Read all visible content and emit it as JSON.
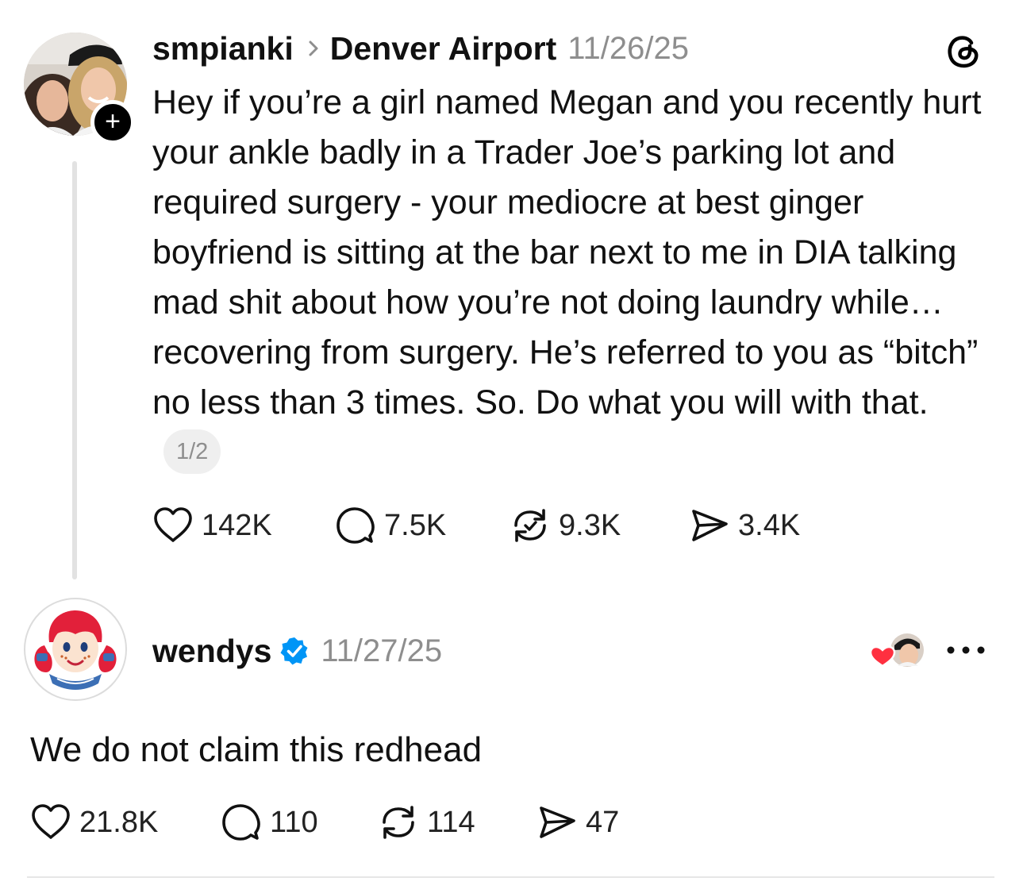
{
  "post": {
    "author": "smpianki",
    "location": "Denver Airport",
    "date": "11/26/25",
    "paragraphs": [
      "Hey if you’re a girl named Megan and you recently hurt your ankle badly in a Trader Joe’s parking lot and required surgery - your mediocre at best ginger boyfriend is sitting at the bar next to me in DIA talking mad shit about how you’re not doing laundry while…recovering from surgery. He’s referred to you as “bitch” no less than 3 times. So. Do what you will with that."
    ],
    "pager": "1/2",
    "stats": {
      "likes": "142K",
      "replies": "7.5K",
      "reposts": "9.3K",
      "shares": "3.4K"
    },
    "icons": [
      "plus-icon",
      "chevron-right-icon",
      "threads-logo-icon",
      "heart-icon",
      "comment-icon",
      "repost-icon",
      "share-icon"
    ]
  },
  "reply": {
    "author": "wendys",
    "verified": true,
    "date": "11/27/25",
    "text": "We do not claim this redhead",
    "stats": {
      "likes": "21.8K",
      "replies": "110",
      "reposts": "114",
      "shares": "47"
    },
    "icons": [
      "verified-badge-icon",
      "liked-by-author-heart-icon",
      "more-options-icon"
    ]
  },
  "colors": {
    "text": "#111111",
    "muted": "#8e8e8e",
    "verified": "#0095f6",
    "heart_red": "#ff3040",
    "wendys_red": "#e2203a"
  }
}
